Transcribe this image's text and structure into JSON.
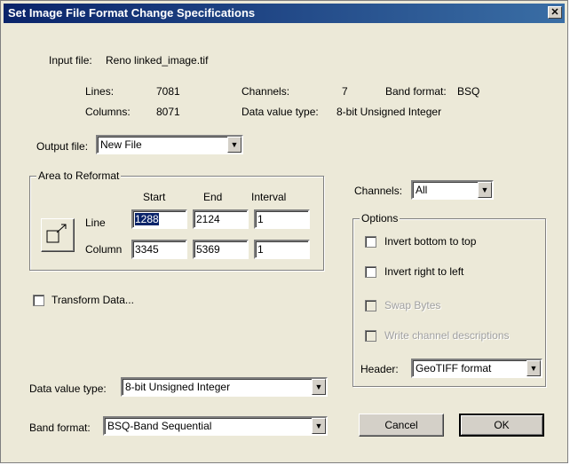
{
  "window": {
    "title": "Set Image File Format Change Specifications",
    "close_glyph": "✕"
  },
  "info": {
    "input_file_label": "Input file:",
    "input_file_value": "Reno linked_image.tif",
    "lines_label": "Lines:",
    "lines_value": "7081",
    "columns_label": "Columns:",
    "columns_value": "8071",
    "channels_label": "Channels:",
    "channels_value": "7",
    "band_format_label": "Band format:",
    "band_format_value": "BSQ",
    "data_value_type_label": "Data value type:",
    "data_value_type_value": "8-bit Unsigned Integer"
  },
  "output_file": {
    "label": "Output file:",
    "value": "New File"
  },
  "area": {
    "title": "Area to Reformat",
    "headers": {
      "start": "Start",
      "end": "End",
      "interval": "Interval"
    },
    "line": {
      "label": "Line",
      "start": "1288",
      "end": "2124",
      "interval": "1"
    },
    "column": {
      "label": "Column",
      "start": "3345",
      "end": "5369",
      "interval": "1"
    }
  },
  "transform": {
    "label": "Transform Data...",
    "checked": false
  },
  "channels": {
    "label": "Channels:",
    "value": "All"
  },
  "options": {
    "title": "Options",
    "invert_bottom": "Invert bottom to top",
    "invert_right": "Invert right to left",
    "swap_bytes": "Swap Bytes",
    "write_channel": "Write channel descriptions",
    "header_label": "Header:",
    "header_value": "GeoTIFF format"
  },
  "data_value_type": {
    "label": "Data value type:",
    "value": "8-bit Unsigned Integer"
  },
  "band_format": {
    "label": "Band format:",
    "value": "BSQ-Band Sequential"
  },
  "buttons": {
    "cancel": "Cancel",
    "ok": "OK"
  },
  "icons": {
    "area_select": "area-select-icon",
    "dropdown": "▼"
  },
  "colors": {
    "titlebar": "#0a246a",
    "dialog_bg": "#ece9d8",
    "selection": "#0a246a"
  }
}
